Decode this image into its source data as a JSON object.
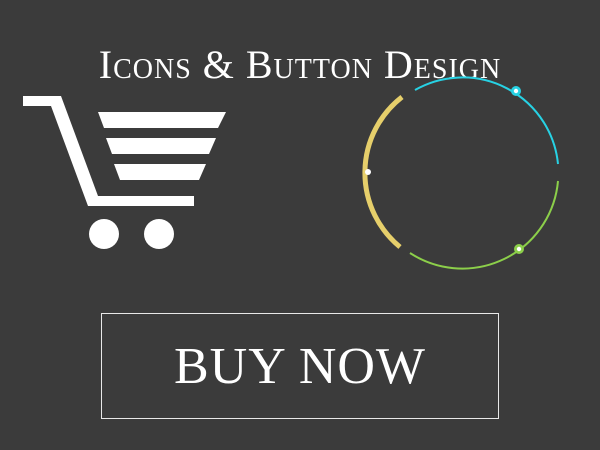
{
  "header": {
    "title": "Icons & Button Design"
  },
  "icons": [
    {
      "name": "shopping-cart-icon",
      "color": "#ffffff"
    },
    {
      "name": "circular-progress-icon",
      "colors": {
        "yellow": "#e6cf6b",
        "cyan": "#27d2e4",
        "green": "#8ccf4a"
      }
    }
  ],
  "button": {
    "label": "BUY NOW",
    "border_color": "#e8e8e8"
  },
  "colors": {
    "background": "#3b3b3b",
    "foreground": "#ffffff"
  }
}
